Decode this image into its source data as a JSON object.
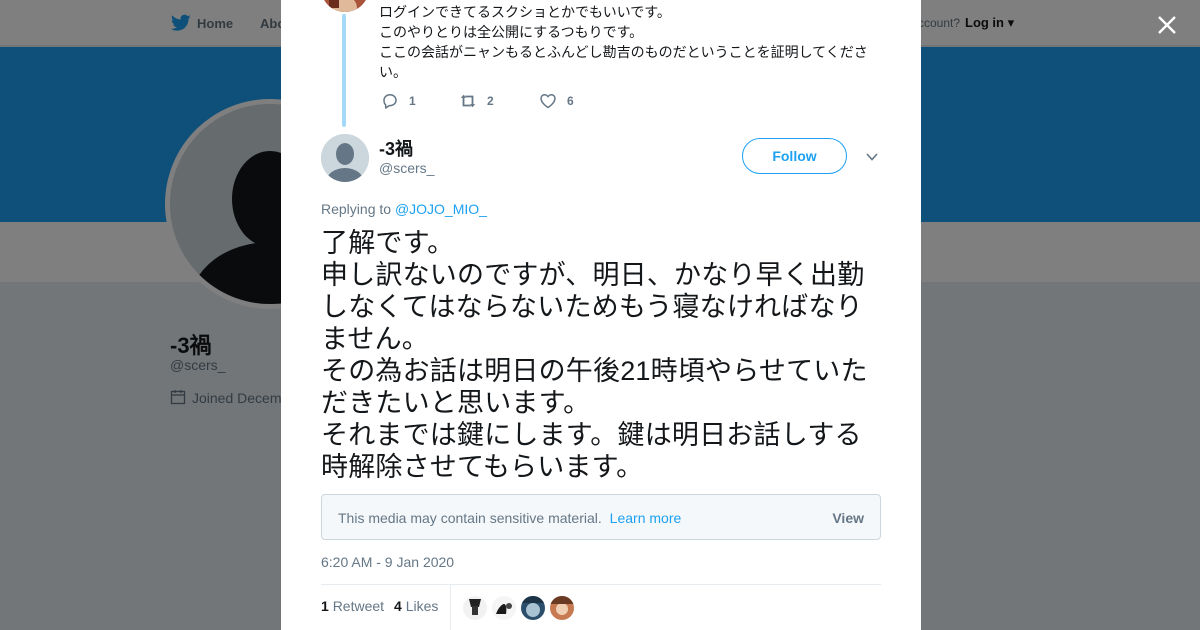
{
  "nav": {
    "home": "Home",
    "about": "Abo",
    "account_prompt": "ccount?",
    "login": "Log in"
  },
  "profile_bg": {
    "name": "-3禍",
    "handle": "@scers_",
    "joined": "Joined Decem"
  },
  "prev_tweet": {
    "lines": [
      "ログインできてるスクショとかでもいいです。",
      "このやりとりは全公開にするつもりです。",
      "ここの会話がニャンもるとふんどし勘吉のものだということを証明してくださ",
      "い。"
    ],
    "replies": "1",
    "retweets": "2",
    "likes": "6"
  },
  "tweet": {
    "name": "-3禍",
    "handle": "@scers_",
    "follow_label": "Follow",
    "replying_prefix": "Replying to",
    "replying_to": "@JOJO_MIO_",
    "text_lines": [
      "了解です。",
      "申し訳ないのですが、明日、かなり早く出勤しなくてはならないためもう寝なければなりません。",
      "その為お話は明日の午後21時頃やらせていただきたいと思います。",
      "それまでは鍵にします。鍵は明日お話しする時解除させてもらいます。"
    ],
    "sensitive_msg": "This media may contain sensitive material.",
    "learn_more": "Learn more",
    "view_label": "View",
    "timestamp": "6:20 AM - 9 Jan 2020",
    "retweet_count": "1",
    "retweet_label": "Retweet",
    "like_count": "4",
    "like_label": "Likes"
  },
  "colors": {
    "accent": "#1da1f2",
    "thread_line": "#a4d9f9",
    "muted": "#657786"
  }
}
